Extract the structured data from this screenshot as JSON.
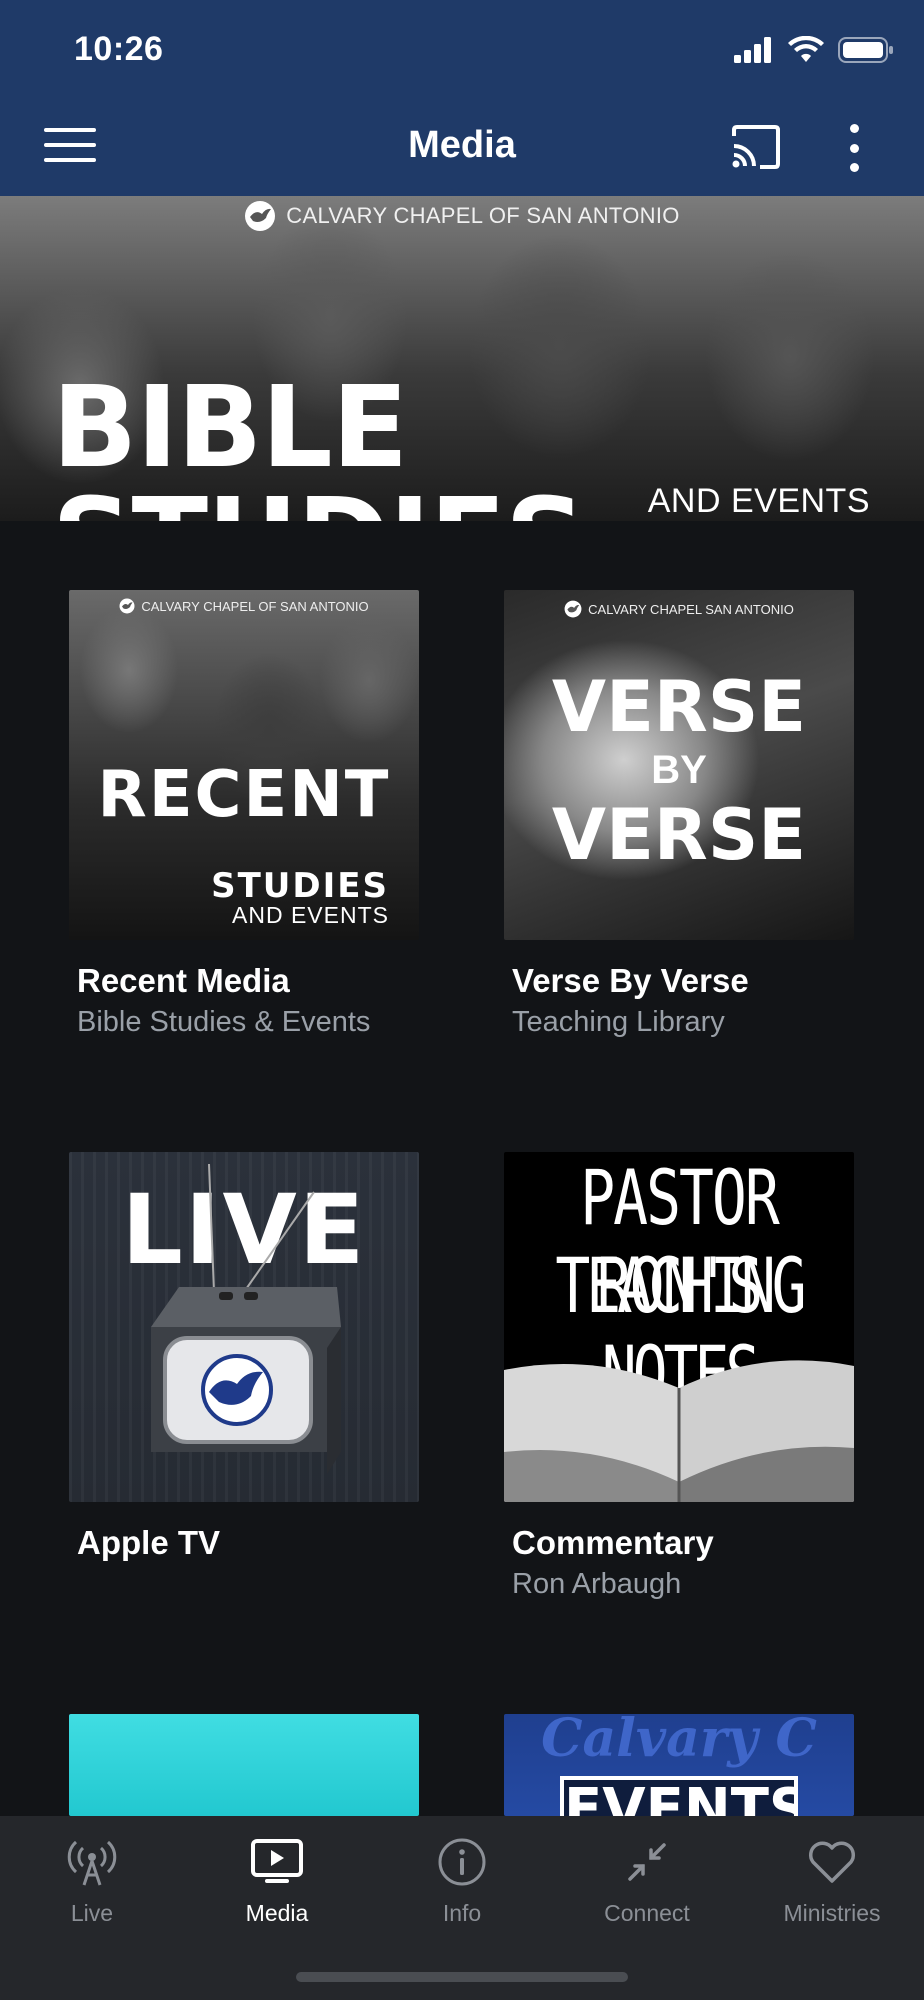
{
  "status_bar": {
    "time": "10:26"
  },
  "header": {
    "title": "Media"
  },
  "hero": {
    "org": "CALVARY CHAPEL OF SAN ANTONIO",
    "title": "BIBLE STUDIES",
    "subtitle": "AND EVENTS"
  },
  "tiles": [
    {
      "title": "Recent Media",
      "subtitle": "Bible Studies & Events",
      "art_org": "CALVARY CHAPEL OF SAN ANTONIO",
      "art_line1": "RECENT",
      "art_line2": "STUDIES",
      "art_line3": "AND EVENTS"
    },
    {
      "title": "Verse By Verse",
      "subtitle": "Teaching Library",
      "art_org": "CALVARY CHAPEL SAN ANTONIO",
      "art_line1": "VERSE",
      "art_line2": "BY",
      "art_line3": "VERSE"
    },
    {
      "title": "Apple TV",
      "subtitle": "",
      "art_line1": "LIVE"
    },
    {
      "title": "Commentary",
      "subtitle": "Ron Arbaugh",
      "art_line1": "PASTOR RON'S",
      "art_line2": "TEACHING NOTES"
    },
    {
      "title": "",
      "subtitle": ""
    },
    {
      "title": "",
      "subtitle": "",
      "art_line1": "Calvary C",
      "art_line2": "EVENTS"
    }
  ],
  "tabbar": {
    "items": [
      {
        "label": "Live",
        "icon": "antenna-icon",
        "active": false
      },
      {
        "label": "Media",
        "icon": "tv-play-icon",
        "active": true
      },
      {
        "label": "Info",
        "icon": "info-icon",
        "active": false
      },
      {
        "label": "Connect",
        "icon": "connect-icon",
        "active": false
      },
      {
        "label": "Ministries",
        "icon": "heart-icon",
        "active": false
      }
    ]
  },
  "colors": {
    "header_bg": "#1f3a68",
    "page_bg": "#121417",
    "tabbar_bg": "#25272b",
    "active_tab": "#ffffff",
    "inactive_tab": "#8b8f96",
    "subtitle_text": "#9aa0a8"
  }
}
